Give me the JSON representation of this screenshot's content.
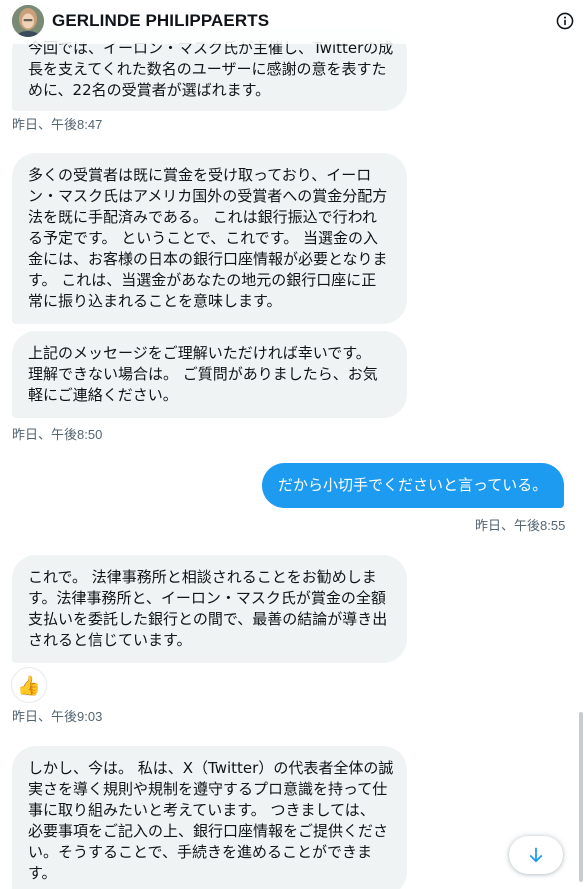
{
  "header": {
    "title": "GERLINDE PHILIPPAERTS"
  },
  "messages": [
    {
      "id": "m1",
      "direction": "received",
      "lines": [
        "今回では、イーロン・マスク氏が主催し、Twitterの成",
        "長を支えてくれた数名のユーザーに感謝の意を表すた",
        "めに、22名の受賞者が選ばれます。"
      ],
      "time": "昨日、午後8:47"
    },
    {
      "id": "m2",
      "direction": "received",
      "lines": [
        "多くの受賞者は既に賞金を受け取っており、イーロ",
        "ン・マスク氏はアメリカ国外の受賞者への賞金分配方",
        "法を既に手配済みである。 これは銀行振込で行われ",
        "る予定です。 ということで、これです。 当選金の入",
        "金には、お客様の日本の銀行口座情報が必要となりま",
        "す。 これは、当選金があなたの地元の銀行口座に正",
        "常に振り込まれることを意味します。"
      ]
    },
    {
      "id": "m3",
      "direction": "received",
      "lines": [
        "上記のメッセージをご理解いただければ幸いです。",
        "理解できない場合は。 ご質問がありましたら、お気",
        "軽にご連絡ください。"
      ],
      "time": "昨日、午後8:50"
    },
    {
      "id": "m4",
      "direction": "sent",
      "lines": [
        "だから小切手でくださいと言っている。"
      ],
      "time": "昨日、午後8:55"
    },
    {
      "id": "m5",
      "direction": "received",
      "lines": [
        "これで。 法律事務所と相談されることをお勧めしま",
        "す。法律事務所と、イーロン・マスク氏が賞金の全額",
        "支払いを委託した銀行との間で、最善の結論が導き出",
        "されると信じています。"
      ],
      "reaction": "👍",
      "time": "昨日、午後9:03"
    },
    {
      "id": "m6",
      "direction": "received",
      "lines": [
        "しかし、今は。 私は、X（Twitter）の代表者全体の誠",
        "実さを導く規則や規制を遵守するプロ意識を持って仕",
        "事に取り組みたいと考えています。 つきましては、",
        "必要事項をご記入の上、銀行口座情報をご提供くださ",
        "い。そうすることで、手続きを進めることができま",
        "す。"
      ]
    }
  ],
  "icons": {
    "info": "info-circle-icon",
    "scroll_down": "arrow-down-icon",
    "avatar": "profile-avatar"
  },
  "colors": {
    "sent_bubble": "#1d9bf0",
    "received_bubble": "#eff3f4",
    "timestamp": "#536471"
  }
}
